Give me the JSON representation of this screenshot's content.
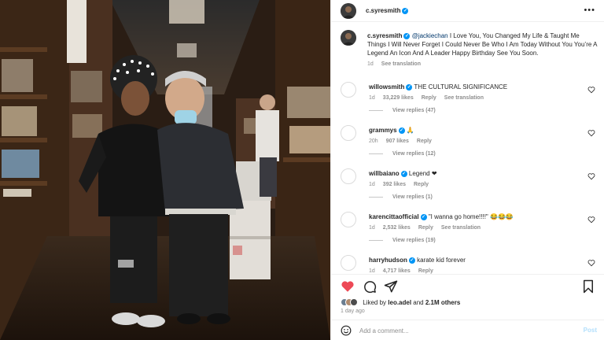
{
  "post": {
    "author": "c.syresmith",
    "caption": {
      "mention": "@jackiechan",
      "text": "I Love You, You Changed My Life & Taught Me Things I Will Never Forget I Could Never Be Who I Am Today Without You You’re A Legend An Icon And A Leader Happy Birthday See You Soon.",
      "time": "1d",
      "translation": "See translation"
    }
  },
  "comments": [
    {
      "user": "willowsmith",
      "text": "THE CULTURAL SIGNIFICANCE",
      "time": "1d",
      "likes": "33,229 likes",
      "reply": "Reply",
      "translation": "See translation",
      "replies": "View replies (47)"
    },
    {
      "user": "grammys",
      "text": "🙏",
      "time": "20h",
      "likes": "907 likes",
      "reply": "Reply",
      "replies": "View replies (12)"
    },
    {
      "user": "willbaiano",
      "text": "Legend ❤",
      "time": "1d",
      "likes": "392 likes",
      "reply": "Reply",
      "replies": "View replies (1)"
    },
    {
      "user": "karencittaofficial",
      "text": "\"I wanna go home!!!!\" 😂😂😂",
      "time": "1d",
      "likes": "2,532 likes",
      "reply": "Reply",
      "translation": "See translation",
      "replies": "View replies (19)"
    },
    {
      "user": "harryhudson",
      "text": "karate kid forever",
      "time": "1d",
      "likes": "4,717 likes",
      "reply": "Reply"
    }
  ],
  "likes": {
    "prefix": "Liked by ",
    "user": "leo.adel",
    "connector": " and ",
    "others": "2.1M others"
  },
  "posted_ago": "1 day ago",
  "composer": {
    "placeholder": "Add a comment...",
    "post_label": "Post"
  },
  "icons": {
    "more": "more-options-icon",
    "like": "heart-filled-icon",
    "comment": "speech-bubble-icon",
    "share": "paper-plane-icon",
    "save": "bookmark-icon",
    "emoji": "emoji-icon"
  },
  "colors": {
    "like": "#ed4956",
    "verified": "#0095f6",
    "muted": "#8e8e8e",
    "post_button": "#b2dffc"
  }
}
